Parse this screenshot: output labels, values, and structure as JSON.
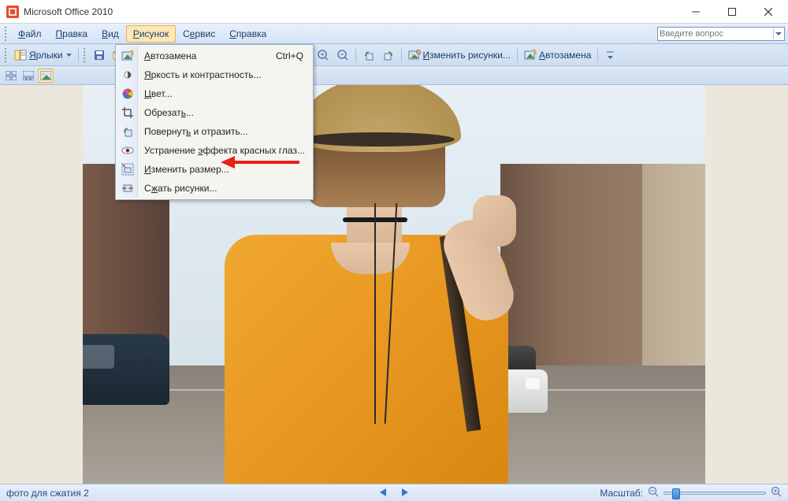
{
  "titlebar": {
    "title": "Microsoft Office 2010"
  },
  "menubar": {
    "items": [
      {
        "pre": "",
        "ul": "Ф",
        "post": "айл"
      },
      {
        "pre": "",
        "ul": "П",
        "post": "равка"
      },
      {
        "pre": "",
        "ul": "В",
        "post": "ид"
      },
      {
        "pre": "",
        "ul": "Р",
        "post": "исунок"
      },
      {
        "pre": "С",
        "ul": "е",
        "post": "рвис"
      },
      {
        "pre": "",
        "ul": "С",
        "post": "правка"
      }
    ],
    "help_placeholder": "Введите вопрос"
  },
  "toolbar": {
    "shortcuts_label": {
      "pre": "",
      "ul": "Я",
      "post": "рлыки"
    },
    "edit_pictures_label": {
      "pre": "",
      "ul": "И",
      "post": "зменить рисунки..."
    },
    "autocorrect_label": {
      "pre": "",
      "ul": "А",
      "post": "втозамена"
    }
  },
  "dropdown": {
    "items": [
      {
        "icon": "autocorrect",
        "pre": "",
        "ul": "А",
        "post": "втозамена",
        "shortcut": "Ctrl+Q"
      },
      {
        "icon": "brightness",
        "pre": "",
        "ul": "Я",
        "post": "ркость и контрастность..."
      },
      {
        "icon": "color",
        "pre": "",
        "ul": "Ц",
        "post": "вет..."
      },
      {
        "icon": "crop",
        "pre": "Обрезат",
        "ul": "ь",
        "post": "..."
      },
      {
        "icon": "rotate",
        "pre": "Повернут",
        "ul": "ь",
        "post": " и отразить..."
      },
      {
        "icon": "redeye",
        "pre": "Устранение ",
        "ul": "э",
        "post": "ффекта красных глаз..."
      },
      {
        "icon": "resize",
        "pre": "",
        "ul": "И",
        "post": "зменить размер..."
      },
      {
        "icon": "compress",
        "pre": "С",
        "ul": "ж",
        "post": "ать рисунки..."
      }
    ]
  },
  "statusbar": {
    "filename": "фото для сжатия 2",
    "zoom_label": "Масштаб:"
  }
}
